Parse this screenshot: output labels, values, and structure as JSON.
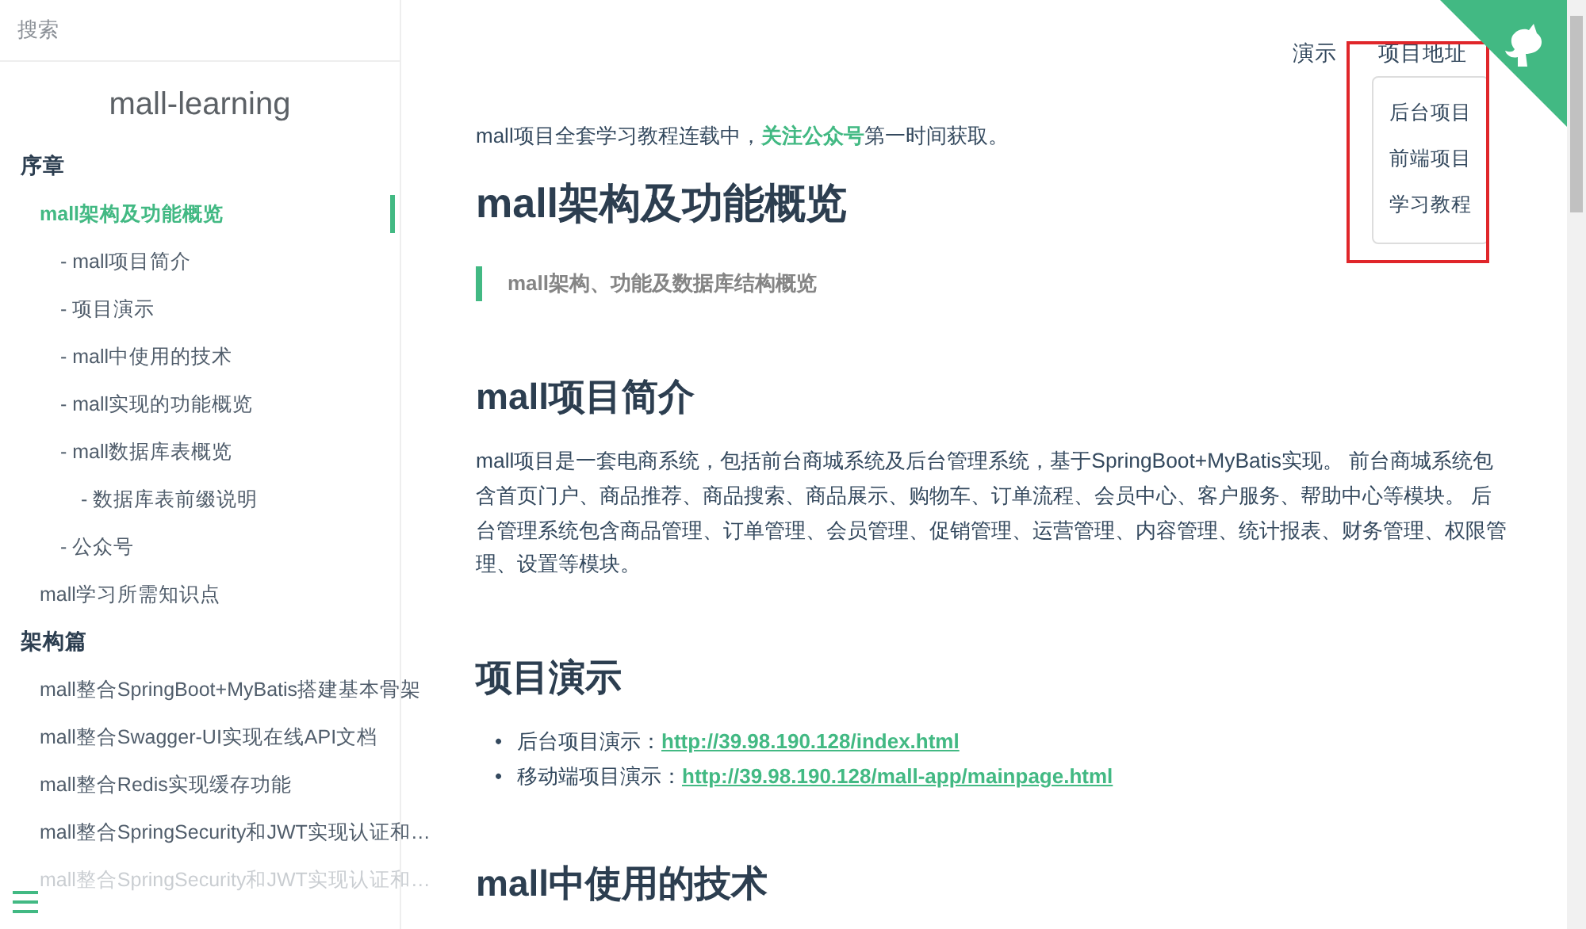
{
  "sidebar": {
    "search": {
      "placeholder": "搜索"
    },
    "app_name": "mall-learning",
    "sections": [
      {
        "title": "序章",
        "items": [
          {
            "label": "mall架构及功能概览",
            "selected": true,
            "dimmed": false,
            "children": [
              {
                "label": "- mall项目简介",
                "selected": false,
                "dimmed": false
              },
              {
                "label": "- 项目演示",
                "selected": false,
                "dimmed": false
              },
              {
                "label": "- mall中使用的技术",
                "selected": false,
                "dimmed": false
              },
              {
                "label": "- mall实现的功能概览",
                "selected": false,
                "dimmed": false
              },
              {
                "label": "- mall数据库表概览",
                "selected": false,
                "dimmed": false,
                "children": [
                  {
                    "label": "- 数据库表前缀说明",
                    "selected": false,
                    "dimmed": false
                  }
                ]
              },
              {
                "label": "- 公众号",
                "selected": false,
                "dimmed": false
              }
            ]
          },
          {
            "label": "mall学习所需知识点",
            "selected": false,
            "dimmed": false
          }
        ]
      },
      {
        "title": "架构篇",
        "items": [
          {
            "label": "mall整合SpringBoot+MyBatis搭建基本骨架",
            "selected": false,
            "dimmed": false
          },
          {
            "label": "mall整合Swagger-UI实现在线API文档",
            "selected": false,
            "dimmed": false
          },
          {
            "label": "mall整合Redis实现缓存功能",
            "selected": false,
            "dimmed": false
          },
          {
            "label": "mall整合SpringSecurity和JWT实现认证和…",
            "selected": false,
            "dimmed": false
          },
          {
            "label": "mall整合SpringSecurity和JWT实现认证和…",
            "selected": false,
            "dimmed": true
          }
        ]
      }
    ]
  },
  "nav": {
    "links": [
      {
        "label": "演示"
      },
      {
        "label": "项目地址",
        "expanded": true,
        "menu": [
          "后台项目",
          "前端项目",
          "学习教程"
        ]
      }
    ]
  },
  "content": {
    "blocks": [
      {
        "kind": "notice",
        "before": "mall项目全套学习教程连载中，",
        "link": "关注公众号",
        "after": "第一时间获取。"
      },
      {
        "kind": "h1",
        "text": "mall架构及功能概览"
      },
      {
        "kind": "quote",
        "text": "mall架构、功能及数据库结构概览"
      },
      {
        "kind": "h2",
        "text": "mall项目简介"
      },
      {
        "kind": "paragraph",
        "text": "mall项目是一套电商系统，包括前台商城系统及后台管理系统，基于SpringBoot+MyBatis实现。 前台商城系统包含首页门户、商品推荐、商品搜索、商品展示、购物车、订单流程、会员中心、客户服务、帮助中心等模块。 后台管理系统包含商品管理、订单管理、会员管理、促销管理、运营管理、内容管理、统计报表、财务管理、权限管理、设置等模块。"
      },
      {
        "kind": "h2",
        "text": "项目演示"
      },
      {
        "kind": "list",
        "items": [
          {
            "bullet": "•",
            "label": "后台项目演示：",
            "link": "http://39.98.190.128/index.html"
          },
          {
            "bullet": "•",
            "label": "移动端项目演示：",
            "link": "http://39.98.190.128/mall-app/mainpage.html"
          }
        ]
      },
      {
        "kind": "h2",
        "text": "mall中使用的技术"
      }
    ]
  }
}
